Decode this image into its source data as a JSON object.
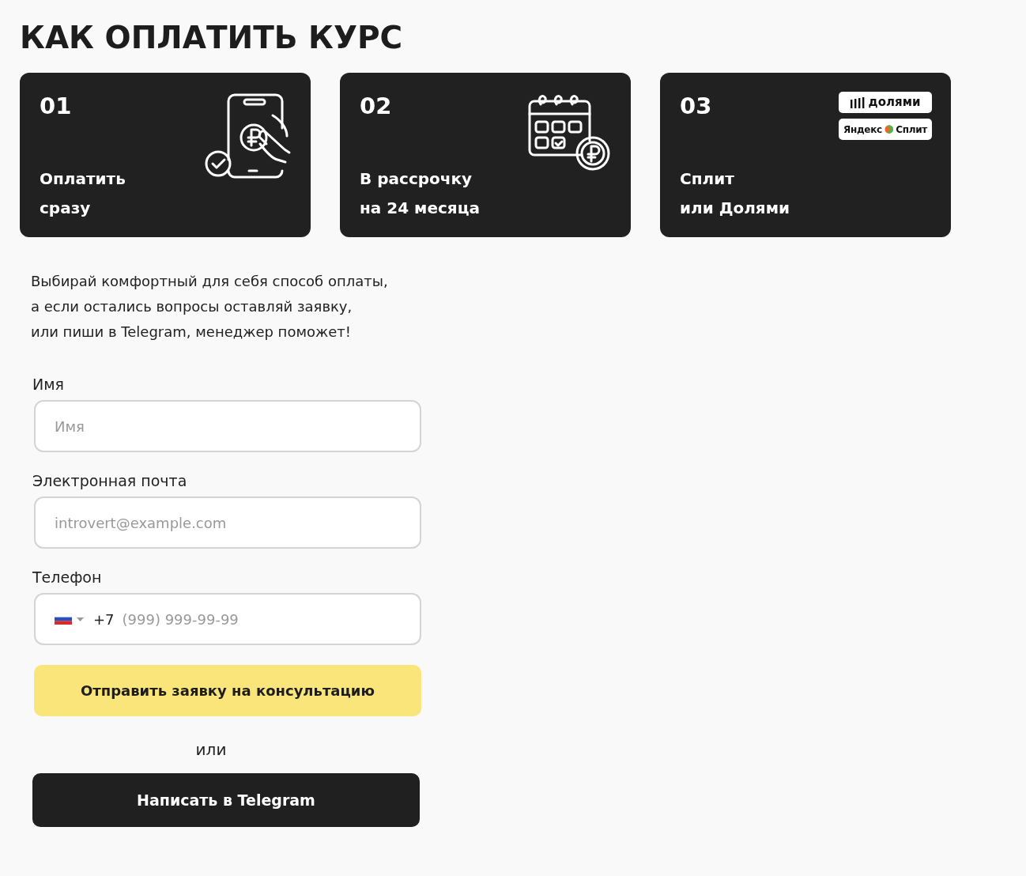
{
  "heading": "КАК ОПЛАТИТЬ КУРС",
  "cards": [
    {
      "number": "01",
      "title": [
        "Оплатить",
        "сразу"
      ],
      "kind": "phone-payment"
    },
    {
      "number": "02",
      "title": [
        "В рассрочку",
        "на 24 месяца"
      ],
      "kind": "calendar"
    },
    {
      "number": "03",
      "title": [
        "Сплит",
        "или Долями"
      ],
      "kind": "badges",
      "badges": [
        {
          "kind": "dolyami",
          "text": "долями"
        },
        {
          "kind": "split",
          "text": [
            "Яндекс",
            "Сплит"
          ]
        }
      ]
    }
  ],
  "intro": [
    "Выбирай комфортный для себя способ оплаты,",
    "а если остались вопросы оставляй заявку,",
    "или пиши в Telegram, менеджер поможет!"
  ],
  "form": {
    "fields": [
      {
        "kind": "text",
        "label": "Имя",
        "placeholder": "Имя"
      },
      {
        "kind": "email",
        "label": "Электронная почта",
        "placeholder": "introvert@example.com"
      },
      {
        "kind": "phone",
        "label": "Телефон",
        "prefix": "+7",
        "placeholder": "(999) 999-99-99"
      }
    ],
    "submit": "Отправить заявку на консультацию",
    "separator": "или",
    "telegram": "Написать в Telegram"
  }
}
